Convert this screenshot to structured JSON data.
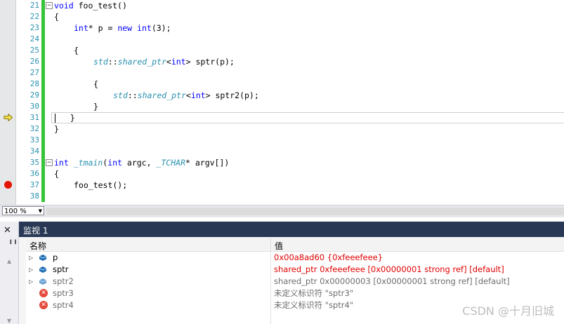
{
  "editor": {
    "lines": [
      {
        "num": "21",
        "indent": 0,
        "outline": "−",
        "tokens": [
          {
            "t": "void",
            "c": "kw"
          },
          {
            "t": " foo_test()",
            "c": ""
          }
        ]
      },
      {
        "num": "22",
        "indent": 0,
        "outline": "",
        "tokens": [
          {
            "t": "{",
            "c": ""
          }
        ]
      },
      {
        "num": "23",
        "indent": 1,
        "outline": "",
        "tokens": [
          {
            "t": "int",
            "c": "kw"
          },
          {
            "t": "* p = ",
            "c": ""
          },
          {
            "t": "new",
            "c": "kw"
          },
          {
            "t": " ",
            "c": ""
          },
          {
            "t": "int",
            "c": "kw"
          },
          {
            "t": "(3);",
            "c": ""
          }
        ]
      },
      {
        "num": "24",
        "indent": 0,
        "outline": "",
        "tokens": []
      },
      {
        "num": "25",
        "indent": 1,
        "outline": "",
        "tokens": [
          {
            "t": "{",
            "c": ""
          }
        ]
      },
      {
        "num": "26",
        "indent": 2,
        "outline": "",
        "tokens": [
          {
            "t": "std",
            "c": "ty"
          },
          {
            "t": "::",
            "c": ""
          },
          {
            "t": "shared_ptr",
            "c": "ty"
          },
          {
            "t": "<",
            "c": ""
          },
          {
            "t": "int",
            "c": "kw"
          },
          {
            "t": "> sptr(p);",
            "c": ""
          }
        ]
      },
      {
        "num": "27",
        "indent": 0,
        "outline": "",
        "tokens": []
      },
      {
        "num": "28",
        "indent": 2,
        "outline": "",
        "tokens": [
          {
            "t": "{",
            "c": ""
          }
        ]
      },
      {
        "num": "29",
        "indent": 3,
        "outline": "",
        "tokens": [
          {
            "t": "std",
            "c": "ty"
          },
          {
            "t": "::",
            "c": ""
          },
          {
            "t": "shared_ptr",
            "c": "ty"
          },
          {
            "t": "<",
            "c": ""
          },
          {
            "t": "int",
            "c": "kw"
          },
          {
            "t": "> sptr2(p);",
            "c": ""
          }
        ]
      },
      {
        "num": "30",
        "indent": 2,
        "outline": "",
        "tokens": [
          {
            "t": "}",
            "c": ""
          }
        ]
      },
      {
        "num": "31",
        "indent": 1,
        "outline": "",
        "tokens": [
          {
            "t": "}",
            "c": ""
          }
        ]
      },
      {
        "num": "32",
        "indent": 0,
        "outline": "",
        "tokens": [
          {
            "t": "}",
            "c": ""
          }
        ]
      },
      {
        "num": "33",
        "indent": 0,
        "outline": "",
        "tokens": []
      },
      {
        "num": "34",
        "indent": 0,
        "outline": "",
        "tokens": []
      },
      {
        "num": "35",
        "indent": 0,
        "outline": "−",
        "tokens": [
          {
            "t": "int",
            "c": "kw"
          },
          {
            "t": " ",
            "c": ""
          },
          {
            "t": "_tmain",
            "c": "ty"
          },
          {
            "t": "(",
            "c": ""
          },
          {
            "t": "int",
            "c": "kw"
          },
          {
            "t": " argc, ",
            "c": ""
          },
          {
            "t": "_TCHAR",
            "c": "ty"
          },
          {
            "t": "* argv[])",
            "c": ""
          }
        ]
      },
      {
        "num": "36",
        "indent": 0,
        "outline": "",
        "tokens": [
          {
            "t": "{",
            "c": ""
          }
        ]
      },
      {
        "num": "37",
        "indent": 1,
        "outline": "",
        "tokens": [
          {
            "t": "foo_test();",
            "c": ""
          }
        ]
      },
      {
        "num": "38",
        "indent": 0,
        "outline": "",
        "tokens": []
      }
    ],
    "current_line": "31",
    "breakpoint_line": "37",
    "arrow_icon": "current-statement-arrow-icon",
    "breakpoint_icon": "breakpoint-icon"
  },
  "zoom": {
    "value": "100 %"
  },
  "watch": {
    "title": "监视 1",
    "columns": {
      "name": "名称",
      "value": "值"
    },
    "rows": [
      {
        "name": "p",
        "value": "0x00a8ad60 {0xfeeefeee}",
        "expandable": true,
        "icon": "variable-icon",
        "style": "red"
      },
      {
        "name": "sptr",
        "value": "shared_ptr 0xfeeefeee [0x00000001 strong ref] [default]",
        "expandable": true,
        "icon": "variable-icon",
        "style": "red"
      },
      {
        "name": "sptr2",
        "value": "shared_ptr 0x00000003 [0x00000001 strong ref] [default]",
        "expandable": true,
        "icon": "variable-icon-inactive",
        "style": "gray"
      },
      {
        "name": "sptr3",
        "value": "未定义标识符 \"sptr3\"",
        "expandable": false,
        "icon": "error-icon",
        "style": "gray"
      },
      {
        "name": "sptr4",
        "value": "未定义标识符 \"sptr4\"",
        "expandable": false,
        "icon": "error-icon",
        "style": "gray"
      }
    ]
  },
  "watermark": "CSDN @十月旧城"
}
